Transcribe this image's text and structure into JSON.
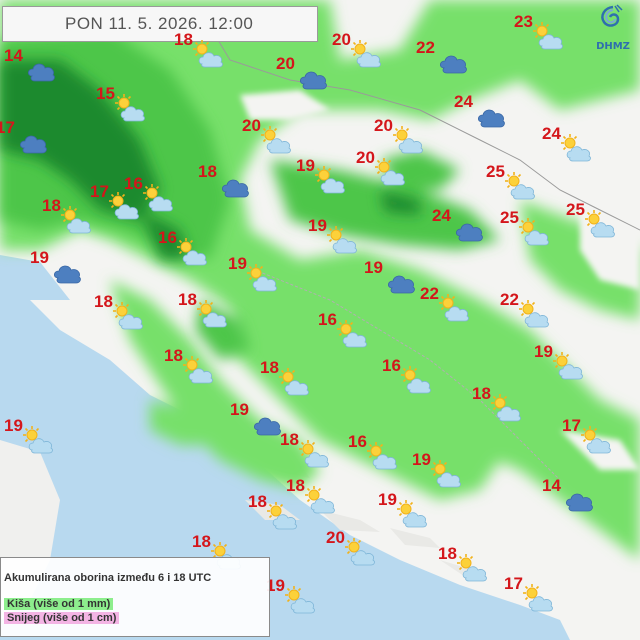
{
  "header": {
    "datetime": "PON  11. 5. 2026. 12:00"
  },
  "logo": {
    "text": "DHMZ"
  },
  "legend": {
    "title": "Akumulirana oborina između 6 i 18 UTC",
    "rain": "Kiša (više od 1 mm)",
    "snow": "Snijeg (više od 1 cm)"
  },
  "colors": {
    "rain_light": "#77e06a",
    "rain_medium": "#4ec64a",
    "rain_heavy": "#1f8a2e",
    "sea": "#b8d9ef",
    "land": "#f4f4f2",
    "temperature": "#d4161b"
  },
  "icon_names": {
    "partly_cloudy": "sun-behind-cloud-icon",
    "cloudy": "cloud-icon"
  },
  "stations": [
    {
      "temp": "18",
      "icon": "partly_cloudy"
    },
    {
      "temp": "20",
      "icon": "partly_cloudy"
    },
    {
      "temp": "22",
      "icon": "cloudy"
    },
    {
      "temp": "23",
      "icon": "partly_cloudy"
    },
    {
      "temp": "14",
      "icon": "cloudy"
    },
    {
      "temp": "20",
      "icon": "cloudy"
    },
    {
      "temp": "15",
      "icon": "partly_cloudy"
    },
    {
      "temp": "24",
      "icon": "cloudy"
    },
    {
      "temp": "17",
      "icon": "cloudy"
    },
    {
      "temp": "20",
      "icon": "partly_cloudy"
    },
    {
      "temp": "20",
      "icon": "partly_cloudy"
    },
    {
      "temp": "24",
      "icon": "partly_cloudy"
    },
    {
      "temp": "18",
      "icon": "cloudy"
    },
    {
      "temp": "19",
      "icon": "partly_cloudy"
    },
    {
      "temp": "20",
      "icon": "partly_cloudy"
    },
    {
      "temp": "25",
      "icon": "partly_cloudy"
    },
    {
      "temp": "17",
      "icon": "partly_cloudy"
    },
    {
      "temp": "16",
      "icon": "partly_cloudy"
    },
    {
      "temp": "18",
      "icon": "partly_cloudy"
    },
    {
      "temp": "24",
      "icon": "cloudy"
    },
    {
      "temp": "25",
      "icon": "partly_cloudy"
    },
    {
      "temp": "25",
      "icon": "partly_cloudy"
    },
    {
      "temp": "19",
      "icon": "partly_cloudy"
    },
    {
      "temp": "16",
      "icon": "partly_cloudy"
    },
    {
      "temp": "19",
      "icon": "cloudy"
    },
    {
      "temp": "19",
      "icon": "partly_cloudy"
    },
    {
      "temp": "19",
      "icon": "cloudy"
    },
    {
      "temp": "22",
      "icon": "partly_cloudy"
    },
    {
      "temp": "18",
      "icon": "partly_cloudy"
    },
    {
      "temp": "18",
      "icon": "partly_cloudy"
    },
    {
      "temp": "22",
      "icon": "partly_cloudy"
    },
    {
      "temp": "16",
      "icon": "partly_cloudy"
    },
    {
      "temp": "19",
      "icon": "partly_cloudy"
    },
    {
      "temp": "18",
      "icon": "partly_cloudy"
    },
    {
      "temp": "18",
      "icon": "partly_cloudy"
    },
    {
      "temp": "16",
      "icon": "partly_cloudy"
    },
    {
      "temp": "18",
      "icon": "partly_cloudy"
    },
    {
      "temp": "19",
      "icon": "cloudy"
    },
    {
      "temp": "19",
      "icon": "partly_cloudy"
    },
    {
      "temp": "17",
      "icon": "partly_cloudy"
    },
    {
      "temp": "18",
      "icon": "partly_cloudy"
    },
    {
      "temp": "16",
      "icon": "partly_cloudy"
    },
    {
      "temp": "19",
      "icon": "partly_cloudy"
    },
    {
      "temp": "14",
      "icon": "cloudy"
    },
    {
      "temp": "18",
      "icon": "partly_cloudy"
    },
    {
      "temp": "18",
      "icon": "partly_cloudy"
    },
    {
      "temp": "19",
      "icon": "partly_cloudy"
    },
    {
      "temp": "20",
      "icon": "partly_cloudy"
    },
    {
      "temp": "18",
      "icon": "partly_cloudy"
    },
    {
      "temp": "17",
      "icon": "partly_cloudy"
    },
    {
      "temp": "19",
      "icon": "partly_cloudy"
    },
    {
      "temp": "18",
      "icon": "partly_cloudy"
    }
  ]
}
